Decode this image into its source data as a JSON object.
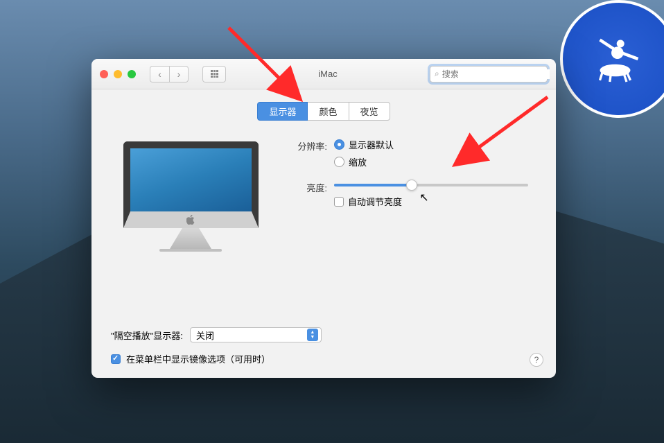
{
  "window": {
    "title": "iMac",
    "search_placeholder": "搜索"
  },
  "tabs": [
    {
      "label": "显示器",
      "active": true
    },
    {
      "label": "颜色",
      "active": false
    },
    {
      "label": "夜览",
      "active": false
    }
  ],
  "settings": {
    "resolution": {
      "label": "分辨率:",
      "options": [
        {
          "label": "显示器默认",
          "checked": true
        },
        {
          "label": "缩放",
          "checked": false
        }
      ]
    },
    "brightness": {
      "label": "亮度:",
      "percent": 40,
      "auto_checkbox": {
        "label": "自动调节亮度",
        "checked": false
      }
    }
  },
  "airplay": {
    "label": "\"隔空播放\"显示器:",
    "selected": "关闭"
  },
  "menubar_checkbox": {
    "label": "在菜单栏中显示镜像选项（可用时）",
    "checked": true
  },
  "help_label": "?",
  "colors": {
    "accent": "#4a90e2",
    "arrow": "#ff2a2a"
  }
}
